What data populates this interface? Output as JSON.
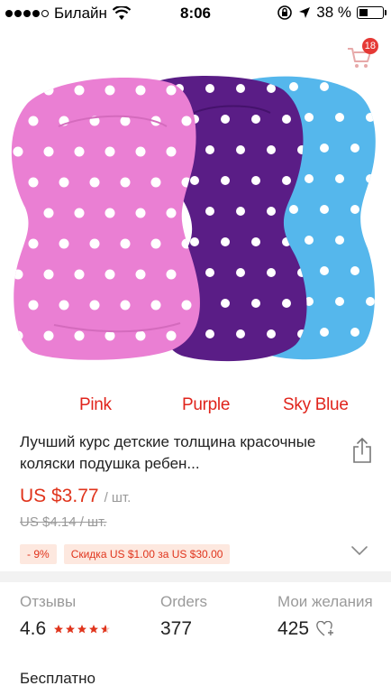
{
  "status_bar": {
    "carrier": "Билайн",
    "time": "8:06",
    "battery": "38 %",
    "battery_fraction": 0.38
  },
  "header": {
    "back_icon": "chevron-left-icon",
    "cart_icon": "cart-icon",
    "cart_count": "18"
  },
  "product_image": {
    "labels": [
      "Pink",
      "Purple",
      "Sky Blue"
    ],
    "colors": {
      "pink": "#ea7fd3",
      "purple": "#5a1d86",
      "blue": "#55b7ec"
    }
  },
  "product": {
    "title": "Лучший курс детские толщина красочные коляски подушка ребен...",
    "price": "US $3.77",
    "unit": "/ шт.",
    "old_price": "US $4.14  / шт.",
    "discount_badge": "- 9%",
    "coupon_badge": "Скидка US $1.00 за US $30.00",
    "share_icon": "share-icon",
    "expand_icon": "chevron-down-icon"
  },
  "stats": {
    "reviews_label": "Отзывы",
    "reviews_value": "4.6",
    "rating": 4.6,
    "orders_label": "Orders",
    "orders_value": "377",
    "wishlist_label": "Мои желания",
    "wishlist_value": "425"
  },
  "shipping": {
    "text": "Бесплатно"
  },
  "colors": {
    "accent": "#e0341c",
    "badge_bg": "#fde8df"
  }
}
